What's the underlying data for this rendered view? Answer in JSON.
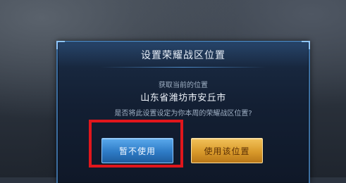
{
  "dialog": {
    "title": "设置荣耀战区位置",
    "subtitle": "获取当前的位置",
    "location": "山东省潍坊市安丘市",
    "question": "是否将此设置设定为你本周的荣耀战区位置?"
  },
  "buttons": {
    "cancel_label": "暂不使用",
    "confirm_label": "使用该位置"
  },
  "colors": {
    "highlight_box": "#e0161c",
    "cancel_button": "#2e7bc6",
    "confirm_button": "#d99a2b"
  }
}
